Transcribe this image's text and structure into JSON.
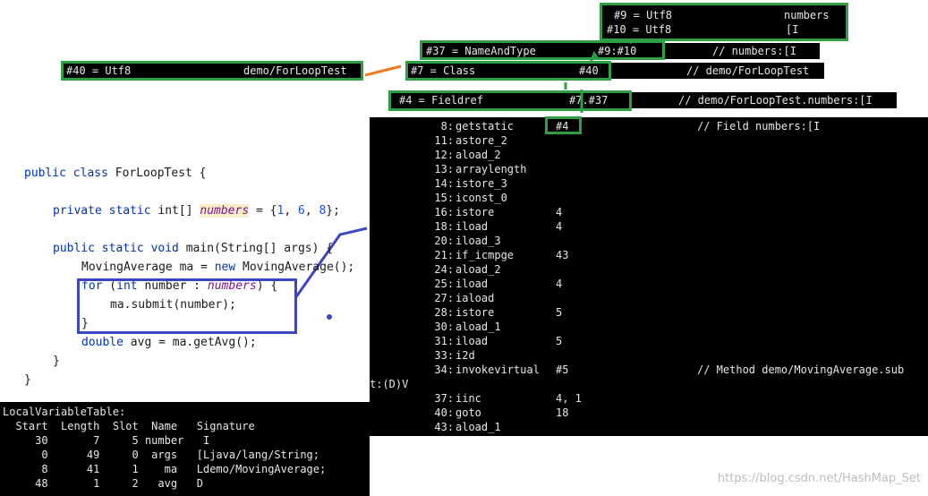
{
  "constant_pool": {
    "utf8_9": "#9 = Utf8",
    "utf8_9_value": "numbers",
    "utf8_10": "#10 = Utf8",
    "utf8_10_value": "[I",
    "name_and_type": "#37 = NameAndType",
    "name_and_type_refs": "#9:#10",
    "name_and_type_comment": "// numbers:[I",
    "utf8_40": "#40 = Utf8",
    "utf8_40_value": "demo/ForLoopTest",
    "class_7": "#7 = Class",
    "class_7_ref": "#40",
    "class_7_comment": "// demo/ForLoopTest",
    "fieldref_4": "#4 = Fieldref",
    "fieldref_4_refs": "#7.#37",
    "fieldref_4_comment": "// demo/ForLoopTest.numbers:[I"
  },
  "bytecode": {
    "rows": [
      {
        "off": "8:",
        "op": "getstatic",
        "arg": "#4",
        "comment": "// Field numbers:[I"
      },
      {
        "off": "11:",
        "op": "astore_2",
        "arg": "",
        "comment": ""
      },
      {
        "off": "12:",
        "op": "aload_2",
        "arg": "",
        "comment": ""
      },
      {
        "off": "13:",
        "op": "arraylength",
        "arg": "",
        "comment": ""
      },
      {
        "off": "14:",
        "op": "istore_3",
        "arg": "",
        "comment": ""
      },
      {
        "off": "15:",
        "op": "iconst_0",
        "arg": "",
        "comment": ""
      },
      {
        "off": "16:",
        "op": "istore",
        "arg": "4",
        "comment": ""
      },
      {
        "off": "18:",
        "op": "iload",
        "arg": "4",
        "comment": ""
      },
      {
        "off": "20:",
        "op": "iload_3",
        "arg": "",
        "comment": ""
      },
      {
        "off": "21:",
        "op": "if_icmpge",
        "arg": "43",
        "comment": ""
      },
      {
        "off": "24:",
        "op": "aload_2",
        "arg": "",
        "comment": ""
      },
      {
        "off": "25:",
        "op": "iload",
        "arg": "4",
        "comment": ""
      },
      {
        "off": "27:",
        "op": "iaload",
        "arg": "",
        "comment": ""
      },
      {
        "off": "28:",
        "op": "istore",
        "arg": "5",
        "comment": ""
      },
      {
        "off": "30:",
        "op": "aload_1",
        "arg": "",
        "comment": ""
      },
      {
        "off": "31:",
        "op": "iload",
        "arg": "5",
        "comment": ""
      },
      {
        "off": "33:",
        "op": "i2d",
        "arg": "",
        "comment": ""
      },
      {
        "off": "34:",
        "op": "invokevirtual",
        "arg": "#5",
        "comment": "// Method demo/MovingAverage.sub"
      },
      {
        "off": "",
        "op": "",
        "arg": "",
        "comment": "",
        "wrap": "t:(D)V"
      },
      {
        "off": "37:",
        "op": "iinc",
        "arg": "4, 1",
        "comment": ""
      },
      {
        "off": "40:",
        "op": "goto",
        "arg": "18",
        "comment": ""
      },
      {
        "off": "43:",
        "op": "aload_1",
        "arg": "",
        "comment": ""
      }
    ]
  },
  "code": {
    "l1_kw": "public class",
    "l1_name": " ForLoopTest {",
    "l2_kw": "private static",
    "l2_type": " int[] ",
    "l2_field": "numbers",
    "l2_eq": " = {",
    "l2_n1": "1",
    "l2_c1": ", ",
    "l2_n2": "6",
    "l2_c2": ", ",
    "l2_n3": "8",
    "l2_end": "};",
    "l3_kw": "public static void",
    "l3_rest": " main(String[] args) {",
    "l4_a": "MovingAverage ma = ",
    "l4_kw": "new",
    "l4_b": " MovingAverage();",
    "l5_kw": "for",
    "l5_a": " (",
    "l5_kw2": "int",
    "l5_b": " number : ",
    "l5_field": "numbers",
    "l5_c": ") {",
    "l6": "ma.submit(number);",
    "l7": "}",
    "l8_kw": "double",
    "l8_rest": " avg = ma.getAvg();",
    "l9": "}",
    "l10": "}"
  },
  "lvt": {
    "title": "LocalVariableTable:",
    "header": "  Start  Length  Slot  Name   Signature",
    "rows": [
      "     30       7     5 number   I",
      "      0      49     0  args   [Ljava/lang/String;",
      "      8      41     1    ma   Ldemo/MovingAverage;",
      "     48       1     2   avg   D"
    ]
  },
  "watermark": "https://blog.csdn.net/HashMap_Set",
  "colors": {
    "green_box": "#2ea043",
    "blue_annotation": "#3a46c4",
    "orange_arrow": "#f07a1e"
  }
}
